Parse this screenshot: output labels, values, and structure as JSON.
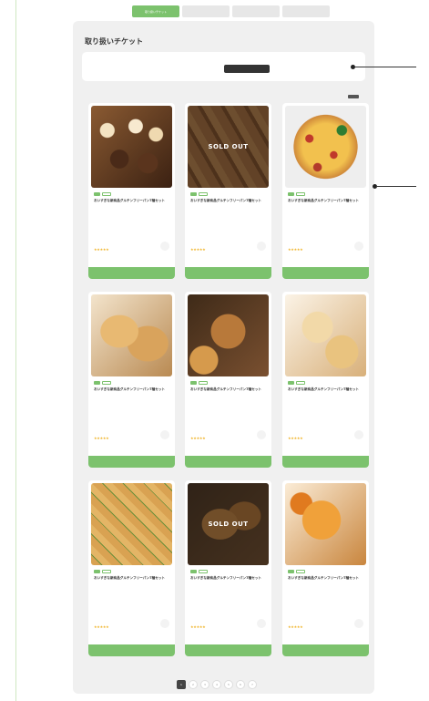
{
  "tabs": [
    {
      "label": "取り扱いチケット",
      "active": true
    },
    {
      "label": "",
      "active": false
    },
    {
      "label": "",
      "active": false
    },
    {
      "label": "",
      "active": false
    }
  ],
  "page_title": "取り扱いチケット",
  "filter": {
    "caption": "",
    "options": [
      "",
      "",
      ""
    ],
    "selected_index": 2
  },
  "results": {
    "count_label": "",
    "sort_label": ""
  },
  "cards": [
    {
      "image": "cupcakes-pastries",
      "sold_out": false,
      "image_caption": "",
      "badges": [
        "",
        ""
      ],
      "title": "おいすぎな新商品グルテンフリーパン7種セット",
      "meta": [
        "",
        ""
      ],
      "price": "",
      "sale": false,
      "stars": "★★★★★",
      "reviews": "",
      "button": ""
    },
    {
      "image": "baguettes",
      "sold_out": true,
      "sold_out_label": "SOLD OUT",
      "image_caption": "",
      "badges": [
        "",
        "",
        ""
      ],
      "title": "おいすぎな新商品グルテンフリーパン7種セット",
      "meta": [
        "",
        ""
      ],
      "price": "",
      "sale": false,
      "stars": "★★★★★",
      "reviews": "",
      "button": ""
    },
    {
      "image": "pizza",
      "sold_out": false,
      "image_caption": "",
      "badges": [
        "",
        ""
      ],
      "title": "おいすぎな新商品グルテンフリーパン7種セット",
      "meta": [
        "",
        ""
      ],
      "price": "",
      "sale": true,
      "stars": "★★★★★",
      "reviews": "",
      "button": ""
    },
    {
      "image": "bread-loaves",
      "sold_out": false,
      "image_caption": "",
      "badges": [
        "",
        ""
      ],
      "title": "おいすぎな新商品グルテンフリーパン7種セット",
      "meta": [
        "",
        ""
      ],
      "price": "",
      "sale": false,
      "stars": "★★★★★",
      "reviews": "",
      "button": ""
    },
    {
      "image": "muffins",
      "sold_out": false,
      "image_caption": "",
      "badges": [
        "",
        "",
        ""
      ],
      "title": "おいすぎな新商品グルテンフリーパン7種セット",
      "meta": [
        "",
        ""
      ],
      "price": "",
      "sale": false,
      "stars": "★★★★★",
      "reviews": "",
      "button": ""
    },
    {
      "image": "cakes",
      "sold_out": false,
      "image_caption": "",
      "badges": [
        "",
        ""
      ],
      "title": "おいすぎな新商品グルテンフリーパン7種セット",
      "meta": [
        "",
        ""
      ],
      "price": "",
      "sale": false,
      "stars": "★★★★★",
      "reviews": "",
      "button": ""
    },
    {
      "image": "garlic-bread",
      "sold_out": false,
      "image_caption": "",
      "badges": [
        "",
        ""
      ],
      "title": "おいすぎな新商品グルテンフリーパン7種セット",
      "meta": [
        "",
        ""
      ],
      "price": "",
      "sale": false,
      "stars": "★★★★★",
      "reviews": "",
      "button": ""
    },
    {
      "image": "croissants",
      "sold_out": true,
      "sold_out_label": "SOLD OUT",
      "image_caption": "",
      "badges": [
        "",
        "",
        ""
      ],
      "title": "おいすぎな新商品グルテンフリーパン7種セット",
      "meta": [
        "",
        ""
      ],
      "price": "",
      "sale": false,
      "stars": "★★★★★",
      "reviews": "",
      "button": ""
    },
    {
      "image": "pumpkin-loaf",
      "sold_out": false,
      "image_caption": "",
      "badges": [
        "",
        ""
      ],
      "title": "おいすぎな新商品グルテンフリーパン7種セット",
      "meta": [
        "",
        ""
      ],
      "price": "",
      "sale": true,
      "stars": "★★★★★",
      "reviews": "",
      "button": ""
    }
  ],
  "pagination": {
    "caption": "",
    "prev": "",
    "next": "",
    "pages": [
      "1",
      "2",
      "3",
      "4",
      "5",
      "6",
      "7"
    ],
    "current_index": 0
  },
  "colors": {
    "accent": "#7cc26d",
    "sale": "#e6626f",
    "star": "#f0b429",
    "panel": "#f0f0f0"
  }
}
